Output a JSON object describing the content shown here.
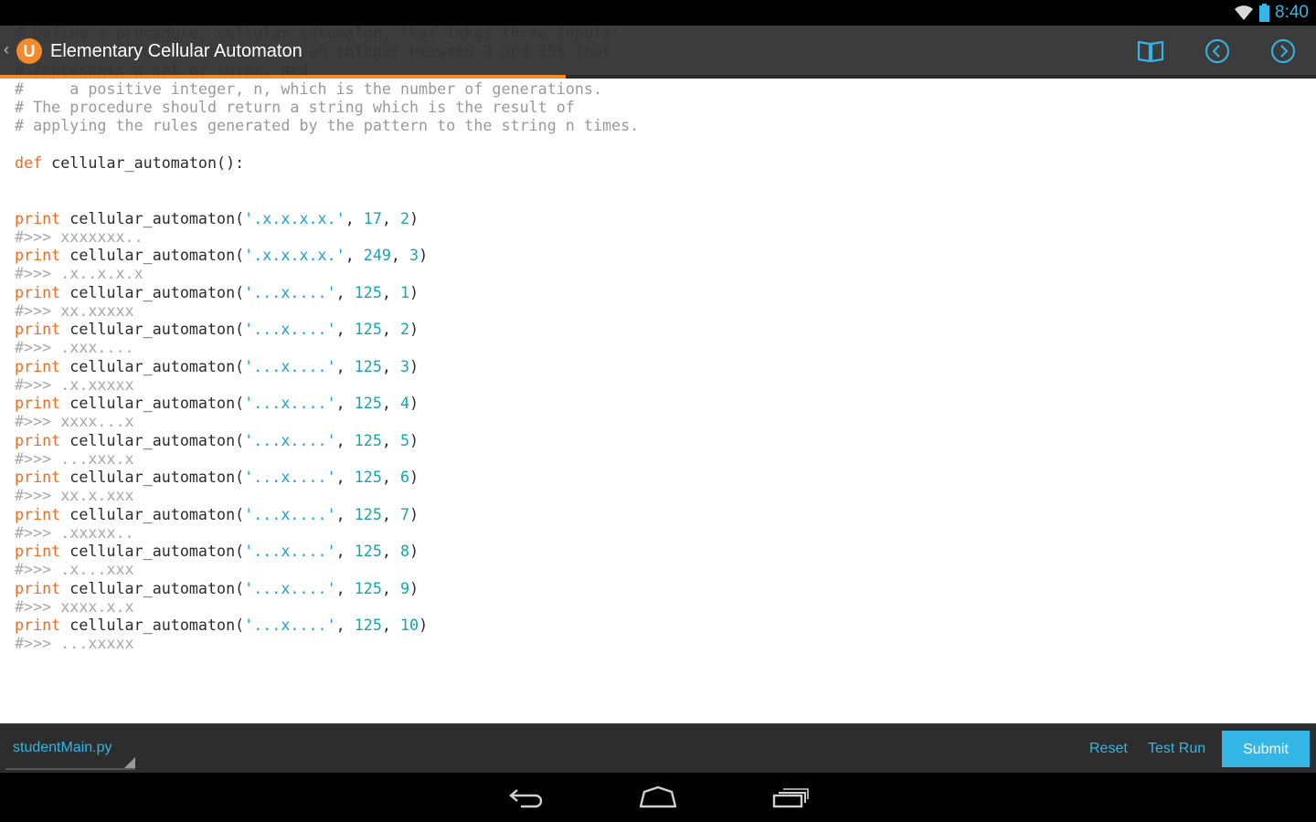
{
  "status_bar": {
    "time": "8:40"
  },
  "action_bar": {
    "title": "Elementary Cellular Automaton",
    "logo_letter": "U",
    "up_caret": "‹",
    "progress_percent": 43,
    "icons": [
      "book-icon",
      "previous-icon",
      "next-icon"
    ]
  },
  "code": {
    "lines": [
      [
        {
          "t": "# Define a procedure, cellular_automaton, that takes three inputs:",
          "c": "cm"
        }
      ],
      [
        {
          "t": "#     a pattern number which is an integer between 0 and 255 that",
          "c": "cm"
        }
      ],
      [
        {
          "t": "# represents a set of rules, and",
          "c": "cm"
        }
      ],
      [
        {
          "t": "#     a positive integer, n, which is the number of generations.",
          "c": "cm"
        }
      ],
      [
        {
          "t": "# The procedure should return a string which is the result of",
          "c": "cm"
        }
      ],
      [
        {
          "t": "# applying the rules generated by the pattern to the string n times.",
          "c": "cm"
        }
      ],
      [],
      [
        {
          "t": "def",
          "c": "kw"
        },
        {
          "t": " cellular_automaton():",
          "c": ""
        }
      ],
      [],
      [],
      [
        {
          "t": "print",
          "c": "kw"
        },
        {
          "t": " cellular_automaton(",
          "c": ""
        },
        {
          "t": "'.x.x.x.x.'",
          "c": "str"
        },
        {
          "t": ", ",
          "c": ""
        },
        {
          "t": "17",
          "c": "num"
        },
        {
          "t": ", ",
          "c": ""
        },
        {
          "t": "2",
          "c": "num"
        },
        {
          "t": ")",
          "c": ""
        }
      ],
      [
        {
          "t": "#>>> xxxxxxx..",
          "c": "out"
        }
      ],
      [
        {
          "t": "print",
          "c": "kw"
        },
        {
          "t": " cellular_automaton(",
          "c": ""
        },
        {
          "t": "'.x.x.x.x.'",
          "c": "str"
        },
        {
          "t": ", ",
          "c": ""
        },
        {
          "t": "249",
          "c": "num"
        },
        {
          "t": ", ",
          "c": ""
        },
        {
          "t": "3",
          "c": "num"
        },
        {
          "t": ")",
          "c": ""
        }
      ],
      [
        {
          "t": "#>>> .x..x.x.x",
          "c": "out"
        }
      ],
      [
        {
          "t": "print",
          "c": "kw"
        },
        {
          "t": " cellular_automaton(",
          "c": ""
        },
        {
          "t": "'...x....'",
          "c": "str"
        },
        {
          "t": ", ",
          "c": ""
        },
        {
          "t": "125",
          "c": "num"
        },
        {
          "t": ", ",
          "c": ""
        },
        {
          "t": "1",
          "c": "num"
        },
        {
          "t": ")",
          "c": ""
        }
      ],
      [
        {
          "t": "#>>> xx.xxxxx",
          "c": "out"
        }
      ],
      [
        {
          "t": "print",
          "c": "kw"
        },
        {
          "t": " cellular_automaton(",
          "c": ""
        },
        {
          "t": "'...x....'",
          "c": "str"
        },
        {
          "t": ", ",
          "c": ""
        },
        {
          "t": "125",
          "c": "num"
        },
        {
          "t": ", ",
          "c": ""
        },
        {
          "t": "2",
          "c": "num"
        },
        {
          "t": ")",
          "c": ""
        }
      ],
      [
        {
          "t": "#>>> .xxx....",
          "c": "out"
        }
      ],
      [
        {
          "t": "print",
          "c": "kw"
        },
        {
          "t": " cellular_automaton(",
          "c": ""
        },
        {
          "t": "'...x....'",
          "c": "str"
        },
        {
          "t": ", ",
          "c": ""
        },
        {
          "t": "125",
          "c": "num"
        },
        {
          "t": ", ",
          "c": ""
        },
        {
          "t": "3",
          "c": "num"
        },
        {
          "t": ")",
          "c": ""
        }
      ],
      [
        {
          "t": "#>>> .x.xxxxx",
          "c": "out"
        }
      ],
      [
        {
          "t": "print",
          "c": "kw"
        },
        {
          "t": " cellular_automaton(",
          "c": ""
        },
        {
          "t": "'...x....'",
          "c": "str"
        },
        {
          "t": ", ",
          "c": ""
        },
        {
          "t": "125",
          "c": "num"
        },
        {
          "t": ", ",
          "c": ""
        },
        {
          "t": "4",
          "c": "num"
        },
        {
          "t": ")",
          "c": ""
        }
      ],
      [
        {
          "t": "#>>> xxxx...x",
          "c": "out"
        }
      ],
      [
        {
          "t": "print",
          "c": "kw"
        },
        {
          "t": " cellular_automaton(",
          "c": ""
        },
        {
          "t": "'...x....'",
          "c": "str"
        },
        {
          "t": ", ",
          "c": ""
        },
        {
          "t": "125",
          "c": "num"
        },
        {
          "t": ", ",
          "c": ""
        },
        {
          "t": "5",
          "c": "num"
        },
        {
          "t": ")",
          "c": ""
        }
      ],
      [
        {
          "t": "#>>> ...xxx.x",
          "c": "out"
        }
      ],
      [
        {
          "t": "print",
          "c": "kw"
        },
        {
          "t": " cellular_automaton(",
          "c": ""
        },
        {
          "t": "'...x....'",
          "c": "str"
        },
        {
          "t": ", ",
          "c": ""
        },
        {
          "t": "125",
          "c": "num"
        },
        {
          "t": ", ",
          "c": ""
        },
        {
          "t": "6",
          "c": "num"
        },
        {
          "t": ")",
          "c": ""
        }
      ],
      [
        {
          "t": "#>>> xx.x.xxx",
          "c": "out"
        }
      ],
      [
        {
          "t": "print",
          "c": "kw"
        },
        {
          "t": " cellular_automaton(",
          "c": ""
        },
        {
          "t": "'...x....'",
          "c": "str"
        },
        {
          "t": ", ",
          "c": ""
        },
        {
          "t": "125",
          "c": "num"
        },
        {
          "t": ", ",
          "c": ""
        },
        {
          "t": "7",
          "c": "num"
        },
        {
          "t": ")",
          "c": ""
        }
      ],
      [
        {
          "t": "#>>> .xxxxx..",
          "c": "out"
        }
      ],
      [
        {
          "t": "print",
          "c": "kw"
        },
        {
          "t": " cellular_automaton(",
          "c": ""
        },
        {
          "t": "'...x....'",
          "c": "str"
        },
        {
          "t": ", ",
          "c": ""
        },
        {
          "t": "125",
          "c": "num"
        },
        {
          "t": ", ",
          "c": ""
        },
        {
          "t": "8",
          "c": "num"
        },
        {
          "t": ")",
          "c": ""
        }
      ],
      [
        {
          "t": "#>>> .x...xxx",
          "c": "out"
        }
      ],
      [
        {
          "t": "print",
          "c": "kw"
        },
        {
          "t": " cellular_automaton(",
          "c": ""
        },
        {
          "t": "'...x....'",
          "c": "str"
        },
        {
          "t": ", ",
          "c": ""
        },
        {
          "t": "125",
          "c": "num"
        },
        {
          "t": ", ",
          "c": ""
        },
        {
          "t": "9",
          "c": "num"
        },
        {
          "t": ")",
          "c": ""
        }
      ],
      [
        {
          "t": "#>>> xxxx.x.x",
          "c": "out"
        }
      ],
      [
        {
          "t": "print",
          "c": "kw"
        },
        {
          "t": " cellular_automaton(",
          "c": ""
        },
        {
          "t": "'...x....'",
          "c": "str"
        },
        {
          "t": ", ",
          "c": ""
        },
        {
          "t": "125",
          "c": "num"
        },
        {
          "t": ", ",
          "c": ""
        },
        {
          "t": "10",
          "c": "num"
        },
        {
          "t": ")",
          "c": ""
        }
      ],
      [
        {
          "t": "#>>> ...xxxxx",
          "c": "out"
        }
      ]
    ]
  },
  "bottom_bar": {
    "file_name": "studentMain.py",
    "reset_label": "Reset",
    "test_run_label": "Test Run",
    "submit_label": "Submit"
  },
  "nav_bar": {
    "icons": [
      "back-icon",
      "home-icon",
      "recent-apps-icon"
    ]
  },
  "colors": {
    "accent_orange": "#f38b2c",
    "accent_blue": "#33b5e5",
    "keyword": "#f26b21",
    "string": "#1aa3d9",
    "number": "#11a8ac",
    "comment": "#9a9a9a"
  }
}
